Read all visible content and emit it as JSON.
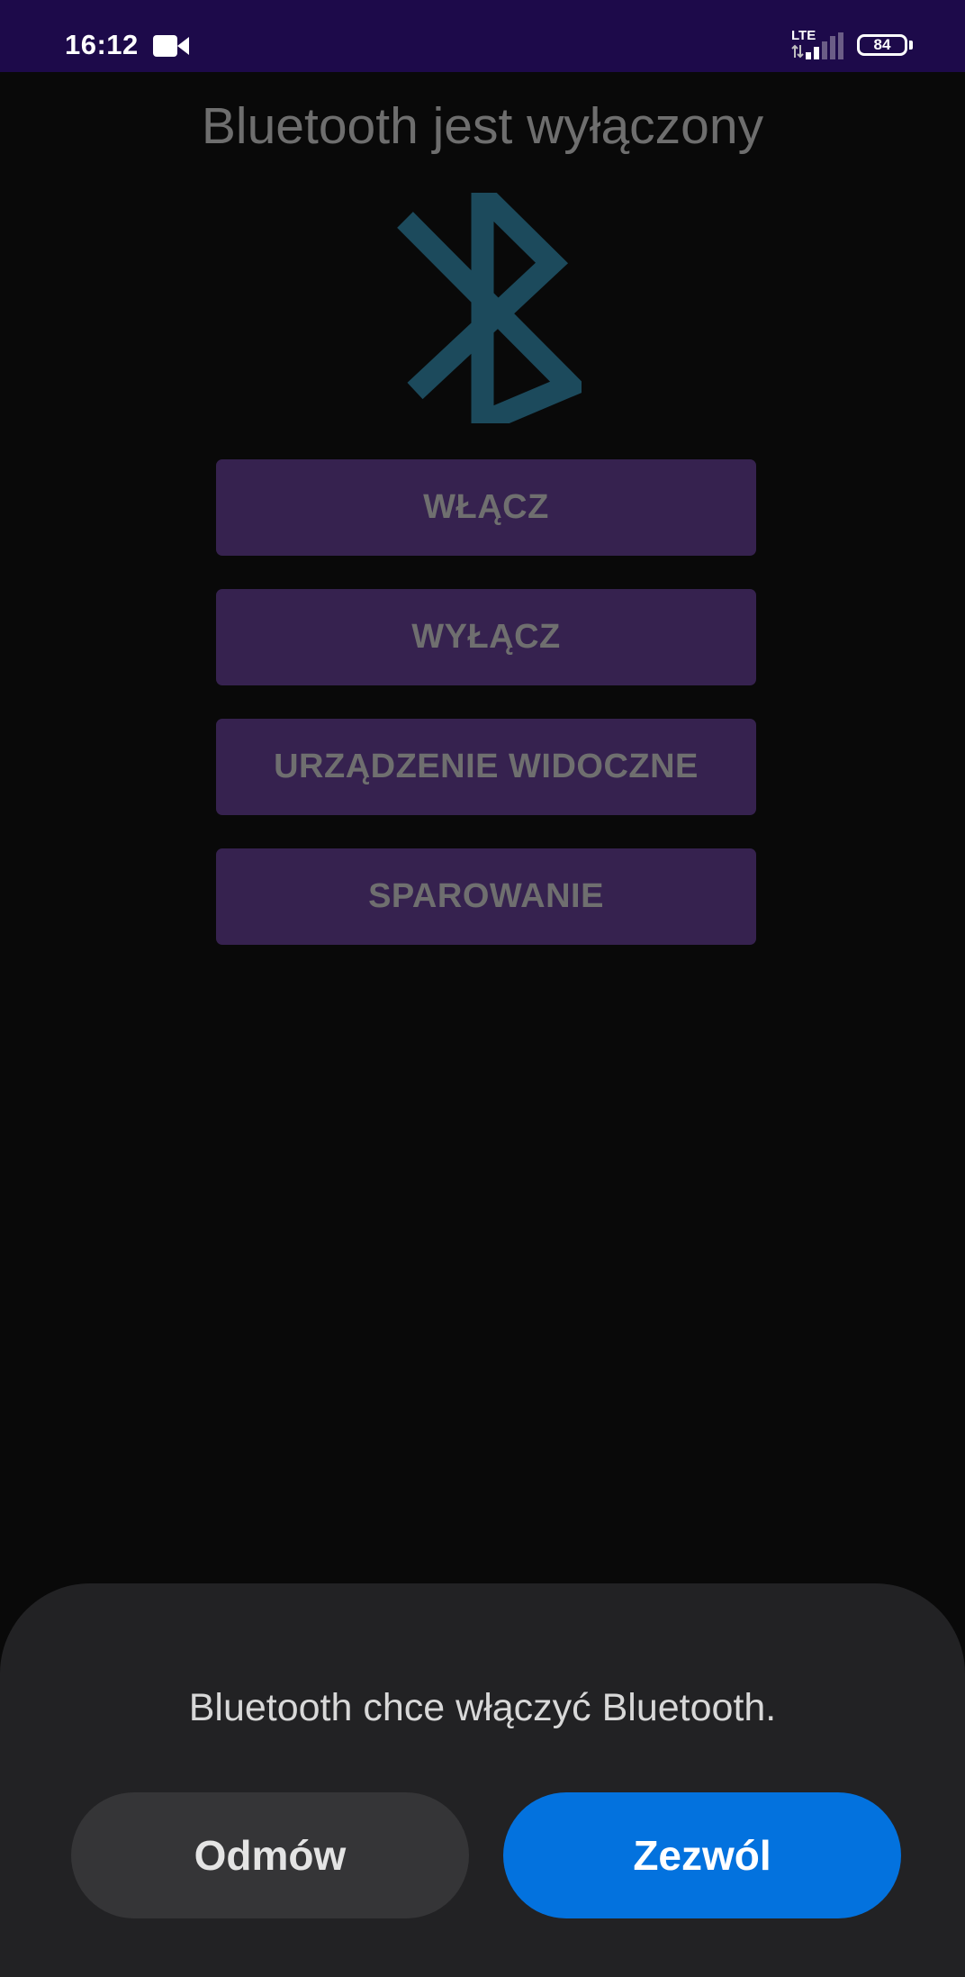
{
  "status_bar": {
    "time": "16:12",
    "network": "LTE",
    "battery": "84"
  },
  "app": {
    "title": "Bluetooth jest wyłączony",
    "buttons": {
      "turn_on": "WŁĄCZ",
      "turn_off": "WYŁĄCZ",
      "visible": "URZĄDZENIE WIDOCZNE",
      "pairing": "SPAROWANIE"
    }
  },
  "dialog": {
    "message": "Bluetooth chce włączyć Bluetooth.",
    "deny_label": "Odmów",
    "allow_label": "Zezwól"
  },
  "icons": {
    "status": [
      "video-camera-icon",
      "lte-icon",
      "signal-icon",
      "battery-icon"
    ],
    "app": "bluetooth-icon"
  },
  "colors": {
    "status_bar_bg": "#1d0a4a",
    "app_bg": "#090909",
    "title_text": "#6e6e6e",
    "bluetooth_logo": "#1c4a5c",
    "action_button_bg": "#36224f",
    "action_button_text": "#6f6f6f",
    "dialog_bg": "#222224",
    "deny_button_bg": "#353537",
    "allow_button_bg": "#0372de"
  }
}
